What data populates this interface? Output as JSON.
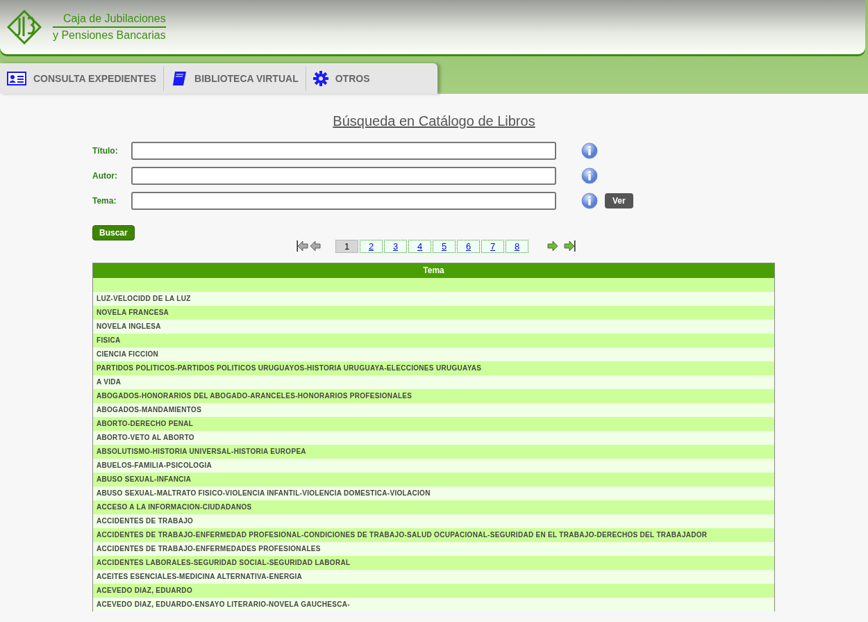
{
  "header": {
    "title_line1": "Caja de Jubilaciones",
    "title_line2": "y Pensiones Bancarias"
  },
  "tabs": [
    {
      "label": "CONSULTA EXPEDIENTES",
      "kind": "card"
    },
    {
      "label": "BIBLIOTECA VIRTUAL",
      "kind": "book"
    },
    {
      "label": "OTROS",
      "kind": "gear"
    }
  ],
  "page_title": "Búsqueda en Catálogo de Libros",
  "form": {
    "fields": [
      {
        "label": "Título:"
      },
      {
        "label": "Autor:"
      },
      {
        "label": "Tema:",
        "extra_button": "Ver"
      }
    ],
    "search_button": "Buscar"
  },
  "pagination": {
    "pages": [
      {
        "label": "1",
        "selected": true
      },
      {
        "label": "2",
        "selected": false
      },
      {
        "label": "3",
        "selected": false
      },
      {
        "label": "4",
        "selected": false
      },
      {
        "label": "5",
        "selected": false
      },
      {
        "label": "6",
        "selected": false
      },
      {
        "label": "7",
        "selected": false
      },
      {
        "label": "8",
        "selected": false
      }
    ]
  },
  "table": {
    "columns": [
      "Tema"
    ],
    "rows": [
      "LUZ-VELOCIDD DE LA LUZ",
      "NOVELA FRANCESA",
      "NOVELA INGLESA",
      "FISICA",
      "CIENCIA FICCION",
      "PARTIDOS POLITICOS-PARTIDOS POLITICOS URUGUAYOS-HISTORIA URUGUAYA-ELECCIONES URUGUAYAS",
      "A VIDA",
      "ABOGADOS-HONORARIOS DEL ABOGADO-ARANCELES-HONORARIOS PROFESIONALES",
      "ABOGADOS-MANDAMIENTOS",
      "ABORTO-DERECHO PENAL",
      "ABORTO-VETO AL ABORTO",
      "ABSOLUTISMO-HISTORIA UNIVERSAL-HISTORIA EUROPEA",
      "ABUELOS-FAMILIA-PSICOLOGIA",
      "ABUSO SEXUAL-INFANCIA",
      "ABUSO SEXUAL-MALTRATO FISICO-VIOLENCIA INFANTIL-VIOLENCIA DOMESTICA-VIOLACION",
      "ACCESO A LA INFORMACION-CIUDADANOS",
      "ACCIDENTES DE TRABAJO",
      "ACCIDENTES DE TRABAJO-ENFERMEDAD PROFESIONAL-CONDICIONES DE TRABAJO-SALUD OCUPACIONAL-SEGURIDAD EN EL TRABAJO-DERECHOS DEL TRABAJADOR",
      "ACCIDENTES DE TRABAJO-ENFERMEDADES PROFESIONALES",
      "ACCIDENTES LABORALES-SEGURIDAD SOCIAL-SEGURIDAD LABORAL",
      "ACEITES ESENCIALES-MEDICINA ALTERNATIVA-ENERGIA",
      "ACEVEDO DIAZ, EDUARDO",
      "ACEVEDO DIAZ, EDUARDO-ENSAYO LITERARIO-NOVELA GAUCHESCA-"
    ]
  }
}
